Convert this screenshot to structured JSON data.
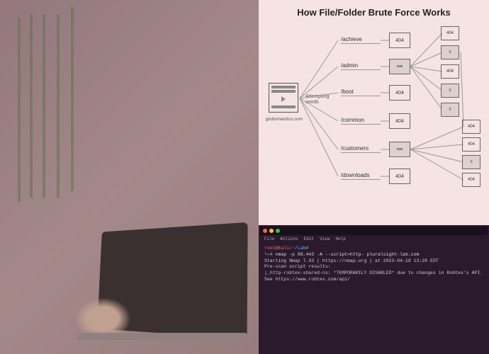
{
  "photo": {
    "description": "Stock photo of person typing on laptop at desk with plants in background, maroon color overlay"
  },
  "diagram": {
    "title": "How File/Folder Brute Force Works",
    "server_label": "globomantics.com",
    "attempting_label": "Attempting words",
    "paths": [
      {
        "path": "/achieve",
        "status": "404"
      },
      {
        "path": "/admin",
        "status": "found"
      },
      {
        "path": "/boot",
        "status": "404"
      },
      {
        "path": "/common",
        "status": "404"
      },
      {
        "path": "/customers",
        "status": "found"
      },
      {
        "path": "/downloads",
        "status": "404"
      }
    ],
    "endpoints_col1": [
      {
        "status": "404"
      },
      {
        "status": "found"
      },
      {
        "status": "404"
      },
      {
        "status": "found"
      },
      {
        "status": "found"
      }
    ],
    "endpoints_col2": [
      {
        "status": "404"
      },
      {
        "status": "404"
      },
      {
        "status": "found"
      },
      {
        "status": "404"
      }
    ]
  },
  "terminal": {
    "menu": [
      "File",
      "Actions",
      "Edit",
      "View",
      "Help"
    ],
    "prompt_user": "root@kali",
    "prompt_path": "~/Lab",
    "command": "nmap -p 80,443 -A --script=http- pluralsight-lab.com",
    "line_starting": "Starting Nmap 7.93 ( https://nmap.org ) at 2023-04-18 13:28 EDT",
    "line_prescan": "Pre-scan script results:",
    "line_disabled": "|_http-robtex-shared-ns: *TEMPORARILY DISABLED* due to changes in Robtex's API. See https://www.robtex.com/api/"
  }
}
